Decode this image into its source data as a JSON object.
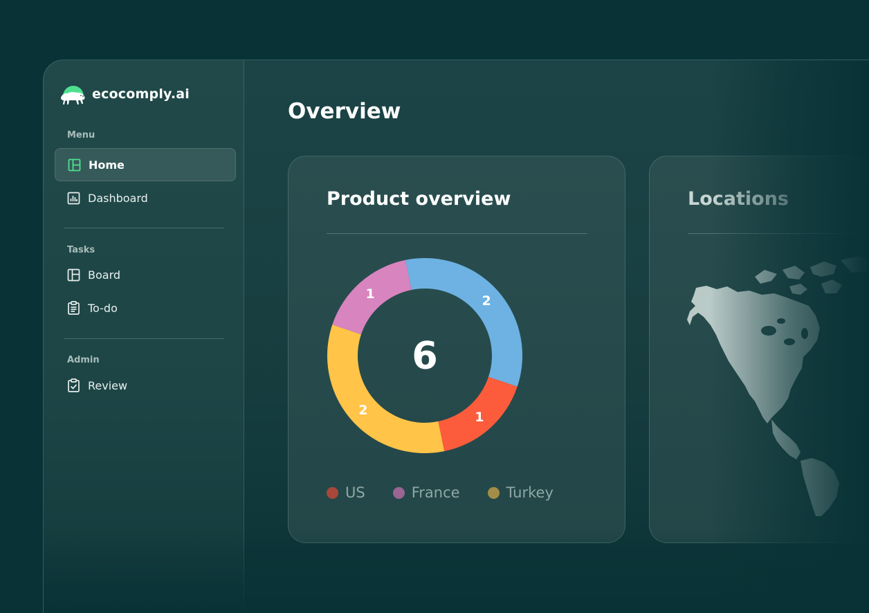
{
  "app": {
    "logo_text": "ecocomply.ai",
    "logo_icon": "panther-icon",
    "accent": "#4ee08f"
  },
  "sidebar": {
    "sections": [
      {
        "label": "Menu",
        "items": [
          {
            "label": "Home",
            "icon": "layout-icon",
            "active": true
          },
          {
            "label": "Dashboard",
            "icon": "bar-chart-icon",
            "active": false
          }
        ]
      },
      {
        "label": "Tasks",
        "items": [
          {
            "label": "Board",
            "icon": "board-icon",
            "active": false
          },
          {
            "label": "To-do",
            "icon": "clipboard-icon",
            "active": false
          }
        ]
      },
      {
        "label": "Admin",
        "items": [
          {
            "label": "Review",
            "icon": "clipboard-check-icon",
            "active": false
          }
        ]
      }
    ]
  },
  "main": {
    "title": "Overview",
    "cards": {
      "product": {
        "title": "Product overview",
        "total": "6",
        "segments": [
          {
            "value": 2,
            "label": "2",
            "color": "#6db2e3"
          },
          {
            "value": 1,
            "label": "1",
            "color": "#fc5c3c"
          },
          {
            "value": 2,
            "label": "2",
            "color": "#ffc448"
          },
          {
            "value": 1,
            "label": "1",
            "color": "#d884bf"
          }
        ],
        "legend": [
          {
            "label": "US",
            "color": "#a9483a"
          },
          {
            "label": "France",
            "color": "#9a6592"
          },
          {
            "label": "Turkey",
            "color": "#a38d47"
          }
        ]
      },
      "locations": {
        "title": "Locations"
      }
    }
  }
}
